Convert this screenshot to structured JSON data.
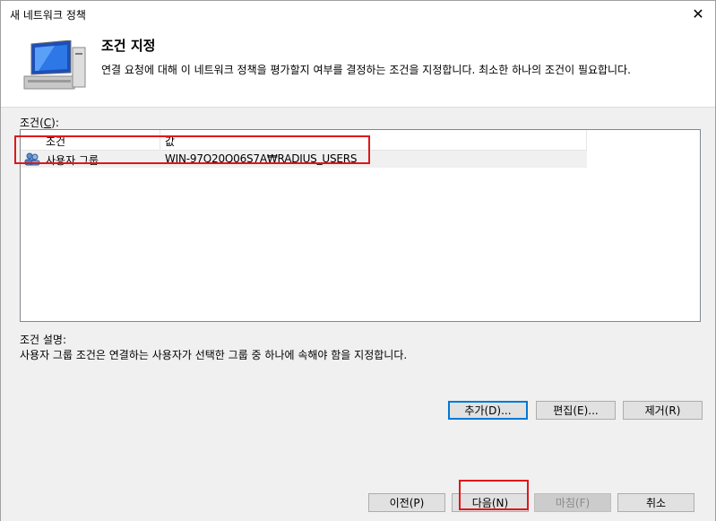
{
  "window": {
    "title": "새 네트워크 정책",
    "close_glyph": "✕"
  },
  "header": {
    "title": "조건 지정",
    "description": "연결 요청에 대해 이 네트워크 정책을 평가할지 여부를 결정하는 조건을 지정합니다. 최소한 하나의 조건이 필요합니다."
  },
  "conditions": {
    "label_prefix": "조건(",
    "label_key": "C",
    "label_suffix": "):",
    "columns": [
      "조건",
      "값"
    ],
    "rows": [
      {
        "icon": "user-group-icon",
        "condition": "사용자 그룹",
        "value": "WIN-97Q20Q06S7A₩RADIUS_USERS"
      }
    ]
  },
  "description": {
    "label": "조건 설명:",
    "text": "사용자 그룹 조건은 연결하는 사용자가 선택한 그룹 중 하나에 속해야 함을 지정합니다."
  },
  "actions": {
    "add": "추가(D)...",
    "edit": "편집(E)...",
    "remove": "제거(R)"
  },
  "footer": {
    "prev": "이전(P)",
    "next": "다음(N)",
    "finish": "마침(F)",
    "cancel": "취소"
  },
  "colors": {
    "highlight": "#e0161b",
    "focus": "#0078d7"
  }
}
